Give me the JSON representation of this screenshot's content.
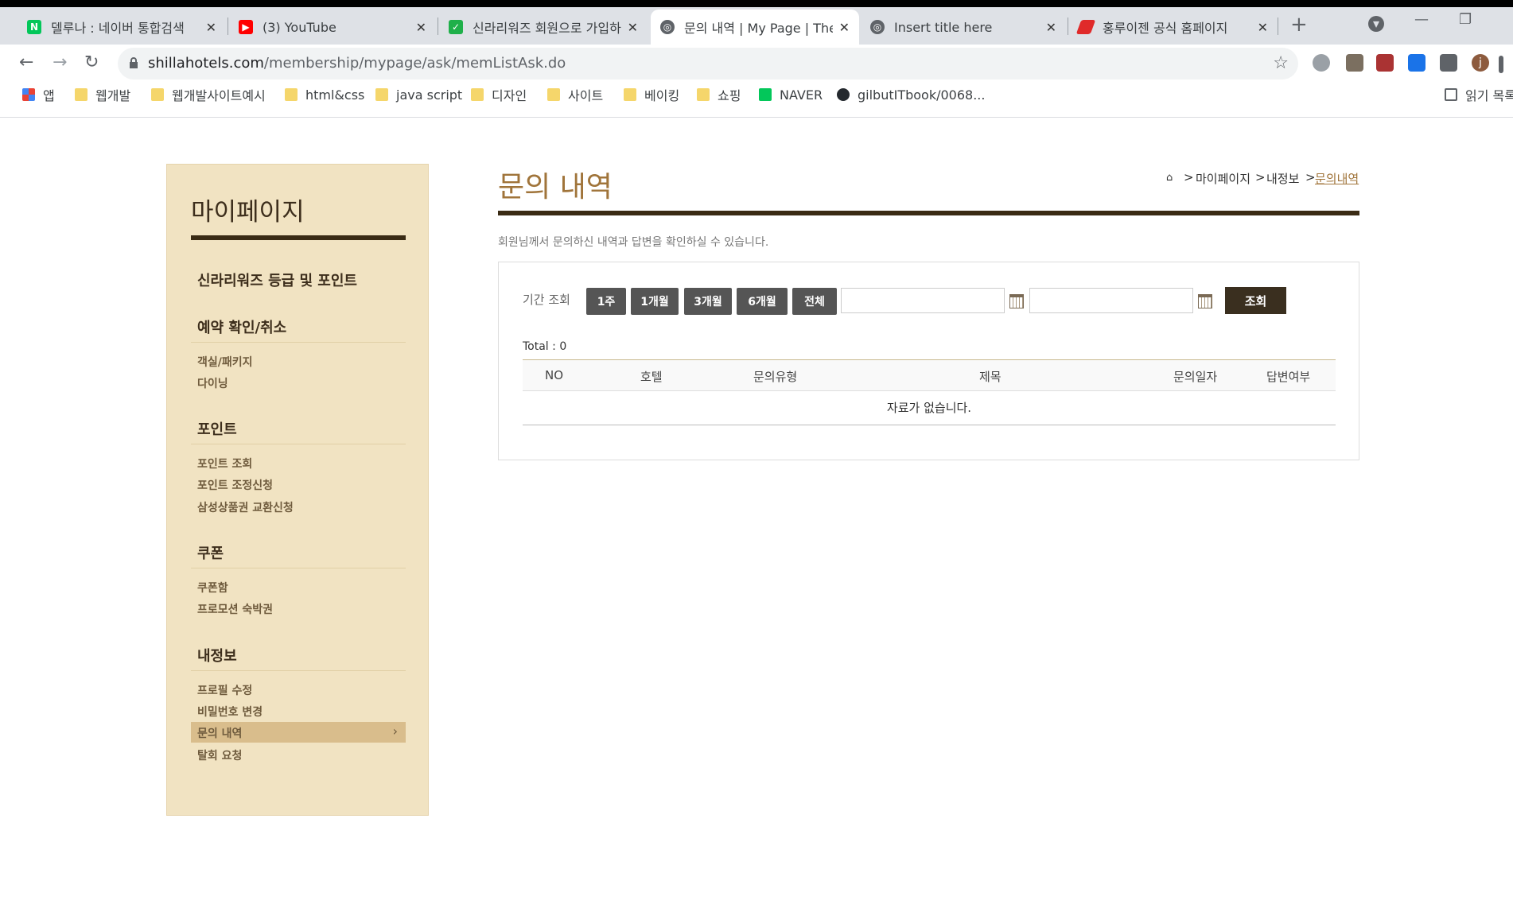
{
  "browser": {
    "tabs": [
      {
        "title": "델루나 : 네이버 통합검색",
        "favicon": "naver-icon"
      },
      {
        "title": "(3) YouTube",
        "favicon": "youtube-icon"
      },
      {
        "title": "신라리워즈 회원으로 가입하",
        "favicon": "shilla-icon"
      },
      {
        "title": "문의 내역 | My Page | The",
        "favicon": "globe-icon"
      },
      {
        "title": "Insert title here",
        "favicon": "globe-icon"
      },
      {
        "title": "홍루이젠 공식 홈페이지",
        "favicon": "hongruizhen-icon"
      }
    ],
    "new_tab": "+",
    "url_host": "shillahotels.com",
    "url_path": "/membership/mypage/ask/memListAsk.do",
    "bookmarks": [
      "앱",
      "웹개발",
      "웹개발사이트예시",
      "html&css",
      "java script",
      "디자인",
      "사이트",
      "베이킹",
      "쇼핑",
      "NAVER",
      "gilbutITbook/0068..."
    ],
    "reading_list": "읽기 목록",
    "profile_initial": "j"
  },
  "sidebar": {
    "title": "마이페이지",
    "rewards": "신라리워즈 등급 및 포인트",
    "reservation": {
      "heading": "예약 확인/취소",
      "items": [
        "객실/패키지",
        "다이닝"
      ]
    },
    "points": {
      "heading": "포인트",
      "items": [
        "포인트 조회",
        "포인트 조정신청",
        "삼성상품권 교환신청"
      ]
    },
    "coupon": {
      "heading": "쿠폰",
      "items": [
        "쿠폰함",
        "프로모션 숙박권"
      ]
    },
    "myinfo": {
      "heading": "내정보",
      "items": [
        "프로필 수정",
        "비밀번호 변경",
        "문의 내역",
        "탈회 요청"
      ],
      "active": "문의 내역"
    }
  },
  "page": {
    "title": "문의 내역",
    "breadcrumb": [
      "마이페이지",
      "내정보",
      "문의내역"
    ],
    "description": "회원님께서 문의하신 내역과 답변을 확인하실 수 있습니다.",
    "period_label": "기간 조회",
    "period_buttons": [
      "1주",
      "1개월",
      "3개월",
      "6개월",
      "전체"
    ],
    "start_date": "",
    "end_date": "",
    "search_button": "조회",
    "total": "Total : 0",
    "columns": [
      "NO",
      "호텔",
      "문의유형",
      "제목",
      "문의일자",
      "답변여부"
    ],
    "empty_message": "자료가 없습니다."
  },
  "colors": {
    "accent": "#a0743a",
    "dark": "#3a2b14",
    "sidebar_bg": "#f1e3c2"
  }
}
